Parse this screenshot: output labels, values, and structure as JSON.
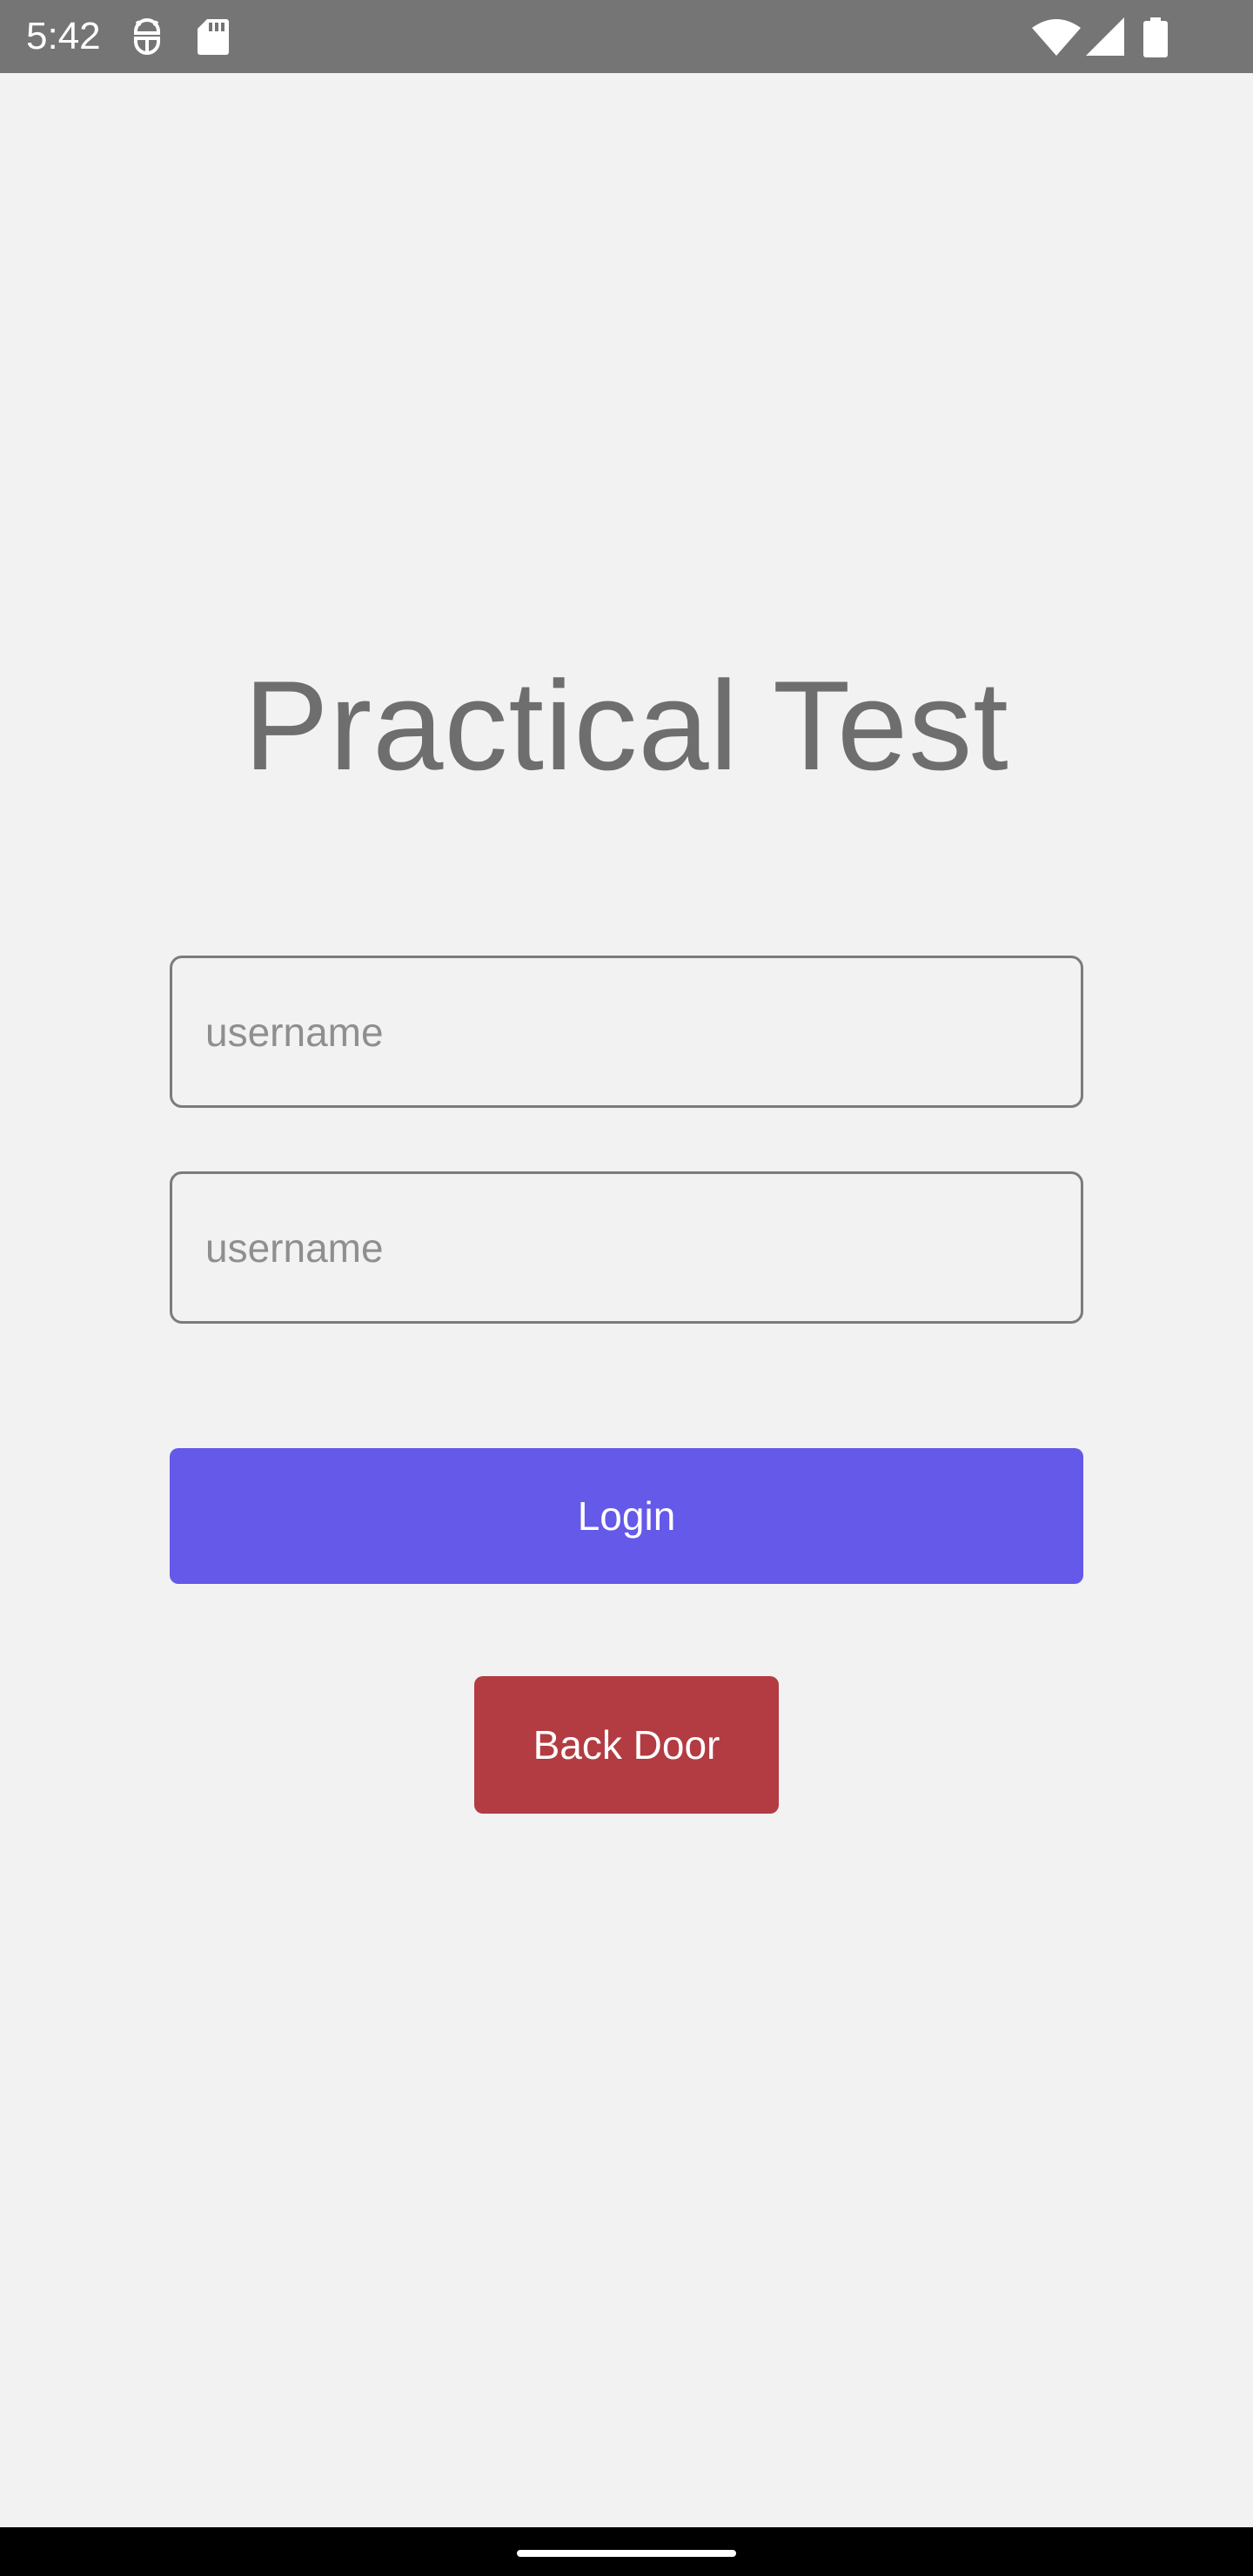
{
  "status_bar": {
    "time": "5:42",
    "icons": [
      "android-debug-icon",
      "sd-card-icon",
      "wifi-icon",
      "cell-signal-icon",
      "battery-icon"
    ]
  },
  "login": {
    "title": "Practical Test",
    "username_placeholder": "username",
    "second_field_placeholder": "username",
    "login_label": "Login",
    "back_door_label": "Back Door"
  },
  "colors": {
    "background": "#f2f2f2",
    "status_bar": "#757575",
    "title_text": "#6e6e6e",
    "login_button": "#6559ea",
    "back_door_button": "#b23c42",
    "field_border": "#7b7b7b"
  }
}
